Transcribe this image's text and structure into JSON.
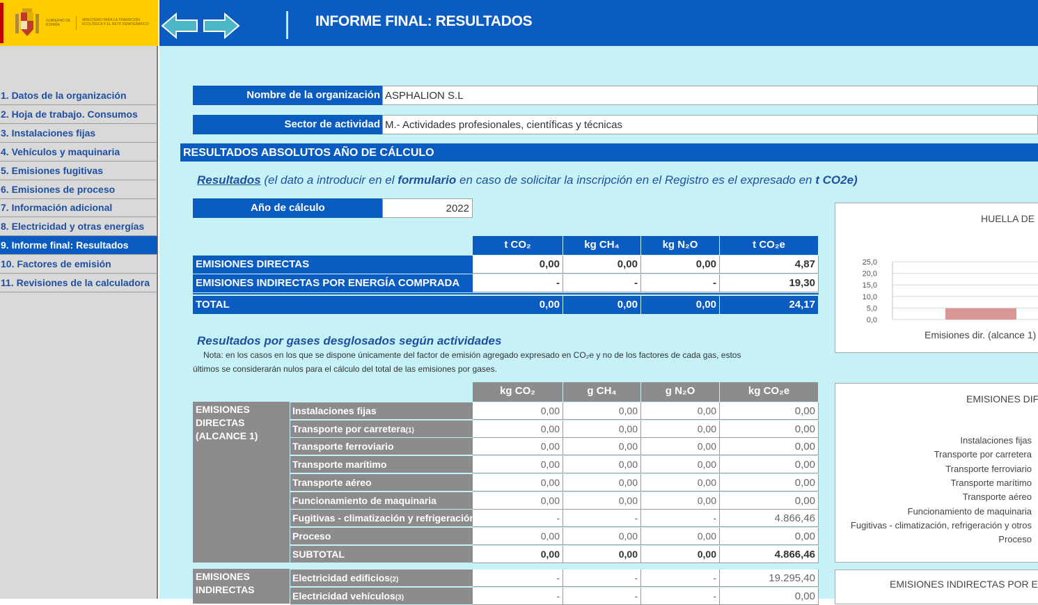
{
  "logo": {
    "gobierno": "GOBIERNO DE ESPAÑA",
    "ministerio": "MINISTERIO PARA LA TRANSICIÓN ECOLÓGICA Y EL RETO DEMOGRÁFICO"
  },
  "sidebar": {
    "items": [
      {
        "label": "1. Datos de la organización"
      },
      {
        "label": "2. Hoja de trabajo. Consumos"
      },
      {
        "label": "3. Instalaciones fijas"
      },
      {
        "label": "4. Vehículos y maquinaria"
      },
      {
        "label": "5. Emisiones fugitivas"
      },
      {
        "label": "6. Emisiones de proceso"
      },
      {
        "label": "7. Información adicional"
      },
      {
        "label": "8. Electricidad y otras energías"
      },
      {
        "label": "9. Informe final: Resultados"
      },
      {
        "label": "10. Factores de emisión"
      },
      {
        "label": "11. Revisiones de la calculadora"
      }
    ]
  },
  "header": {
    "title": "INFORME FINAL: RESULTADOS"
  },
  "org": {
    "name_label": "Nombre de la organización",
    "name_value": "ASPHALION S.L",
    "sector_label": "Sector de actividad",
    "sector_value": "M.- Actividades profesionales, científicas y técnicas"
  },
  "section": {
    "title": "RESULTADOS ABSOLUTOS AÑO DE CÁLCULO",
    "results_link": "Resultados",
    "results_note_a": "(el dato a introducir en el ",
    "results_note_b": "formulario",
    "results_note_c": " en caso de solicitar la inscripción en el Registro es el expresado en ",
    "results_note_d": "t CO2e)"
  },
  "year": {
    "label": "Año  de cálculo",
    "value": "2022"
  },
  "summary": {
    "headers": [
      "t CO₂",
      "kg CH₄",
      "kg N₂O",
      "t CO₂e"
    ],
    "rows": [
      {
        "label": "EMISIONES DIRECTAS",
        "values": [
          "0,00",
          "0,00",
          "0,00",
          "4,87"
        ]
      },
      {
        "label": "EMISIONES INDIRECTAS POR ENERGÍA COMPRADA",
        "values": [
          "-",
          "-",
          "-",
          "19,30"
        ]
      },
      {
        "label": "TOTAL",
        "values": [
          "0,00",
          "0,00",
          "0,00",
          "24,17"
        ]
      }
    ]
  },
  "breakdown": {
    "title": "Resultados por gases desglosados según actividades",
    "note_line1": "Nota: en los casos en los que se dispone únicamente del factor de emisión agregado expresado en CO₂e y no de los factores de cada gas, estos",
    "note_line2": "últimos se considerarán nulos para el cálculo del total de las emisiones por gases.",
    "headers": [
      "kg CO₂",
      "g CH₄",
      "g N₂O",
      "kg CO₂e"
    ],
    "group1_label": "EMISIONES DIRECTAS (ALCANCE 1)",
    "group1_rows": [
      {
        "label": "Instalaciones fijas",
        "values": [
          "0,00",
          "0,00",
          "0,00",
          "0,00"
        ]
      },
      {
        "label": "Transporte por carretera",
        "sup": "(1)",
        "values": [
          "0,00",
          "0,00",
          "0,00",
          "0,00"
        ]
      },
      {
        "label": "Transporte ferroviario",
        "values": [
          "0,00",
          "0,00",
          "0,00",
          "0,00"
        ]
      },
      {
        "label": "Transporte marítimo",
        "values": [
          "0,00",
          "0,00",
          "0,00",
          "0,00"
        ]
      },
      {
        "label": "Transporte aéreo",
        "values": [
          "0,00",
          "0,00",
          "0,00",
          "0,00"
        ]
      },
      {
        "label": "Funcionamiento de maquinaria",
        "values": [
          "0,00",
          "0,00",
          "0,00",
          "0,00"
        ]
      },
      {
        "label": "Fugitivas - climatización y refrigeración",
        "values": [
          "-",
          "-",
          "-",
          "4.866,46"
        ]
      },
      {
        "label": "Proceso",
        "values": [
          "0,00",
          "0,00",
          "0,00",
          "0,00"
        ]
      },
      {
        "label": "SUBTOTAL",
        "values": [
          "0,00",
          "0,00",
          "0,00",
          "4.866,46"
        ]
      }
    ],
    "group2_label": "EMISIONES INDIRECTAS",
    "group2_rows": [
      {
        "label": "Electricidad edificios",
        "sup": "(2)",
        "values": [
          "-",
          "-",
          "-",
          "19.295,40"
        ]
      },
      {
        "label": "Electricidad vehículos",
        "sup": "(3)",
        "values": [
          "-",
          "-",
          "-",
          "0,00"
        ]
      }
    ]
  },
  "panel1": {
    "title": "HUELLA DE",
    "y_ticks": [
      "25,0",
      "20,0",
      "15,0",
      "10,0",
      "5,0",
      "0,0"
    ],
    "x_label": "Emisiones dir. (alcance 1)",
    "bar_color": "#d99694"
  },
  "chart_data": {
    "type": "bar",
    "title": "HUELLA DE",
    "categories": [
      "Emisiones dir. (alcance 1)"
    ],
    "values": [
      4.87
    ],
    "ylim": [
      0,
      25
    ]
  },
  "panel2": {
    "title": "EMISIONES DIF",
    "items": [
      "Instalaciones fijas",
      "Transporte por carretera",
      "Transporte ferroviario",
      "Transporte marítimo",
      "Transporte aéreo",
      "Funcionamiento de maquinaria",
      "Fugitivas - climatización, refrigeración y otros",
      "Proceso"
    ]
  },
  "panel3": {
    "title": "EMISIONES INDIRECTAS POR E"
  },
  "colors": {
    "header_blue": "#0b5cc0",
    "main_bg": "#c6f2f7",
    "logo_yellow": "#ffcc00",
    "grey_label": "#8c8c8c"
  }
}
